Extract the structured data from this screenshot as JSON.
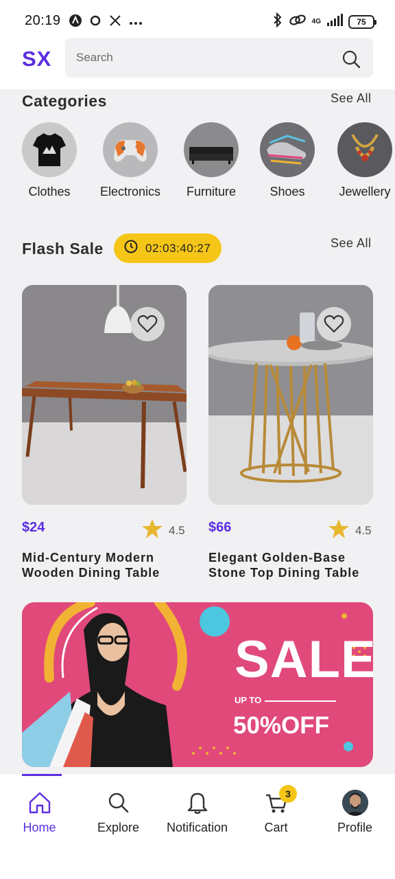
{
  "status_bar": {
    "time": "20:19",
    "network_type": "4G",
    "battery": "75",
    "left_icons": [
      "a-badge-icon",
      "circle-icon",
      "x-logo-icon",
      "more-dots-icon"
    ],
    "right_icons": [
      "bluetooth-icon",
      "link-icon",
      "signal-icon",
      "battery-icon"
    ]
  },
  "header": {
    "logo": "SX",
    "search_placeholder": "Search"
  },
  "categories": {
    "title": "Categories",
    "see_all": "See All",
    "items": [
      {
        "label": "Clothes",
        "color": "#c9c9c9"
      },
      {
        "label": "Electronics",
        "color": "#b9b9bb"
      },
      {
        "label": "Furniture",
        "color": "#8b8b8d"
      },
      {
        "label": "Shoes",
        "color": "#6e6e72"
      },
      {
        "label": "Jewellery",
        "color": "#5a5a5e"
      }
    ]
  },
  "flash_sale": {
    "title": "Flash Sale",
    "timer": "02:03:40:27",
    "see_all": "See All",
    "products": [
      {
        "price": "$24",
        "rating": "4.5",
        "name": "Mid-Century Modern Wooden Dining Table"
      },
      {
        "price": "$66",
        "rating": "4.5",
        "name": "Elegant Golden-Base Stone Top Dining Table"
      }
    ]
  },
  "banner": {
    "headline": "SALE",
    "upto": "UP TO",
    "discount": "50%OFF",
    "background": "#e0497a"
  },
  "bottom_nav": {
    "items": [
      {
        "label": "Home",
        "icon": "home-icon",
        "active": true
      },
      {
        "label": "Explore",
        "icon": "search-icon",
        "active": false
      },
      {
        "label": "Notification",
        "icon": "bell-icon",
        "active": false
      },
      {
        "label": "Cart",
        "icon": "cart-icon",
        "active": false,
        "badge": "3"
      },
      {
        "label": "Profile",
        "icon": "avatar",
        "active": false
      }
    ]
  },
  "colors": {
    "accent": "#5b2ee0",
    "timer_bg": "#f5c518",
    "star": "#e8b730"
  }
}
